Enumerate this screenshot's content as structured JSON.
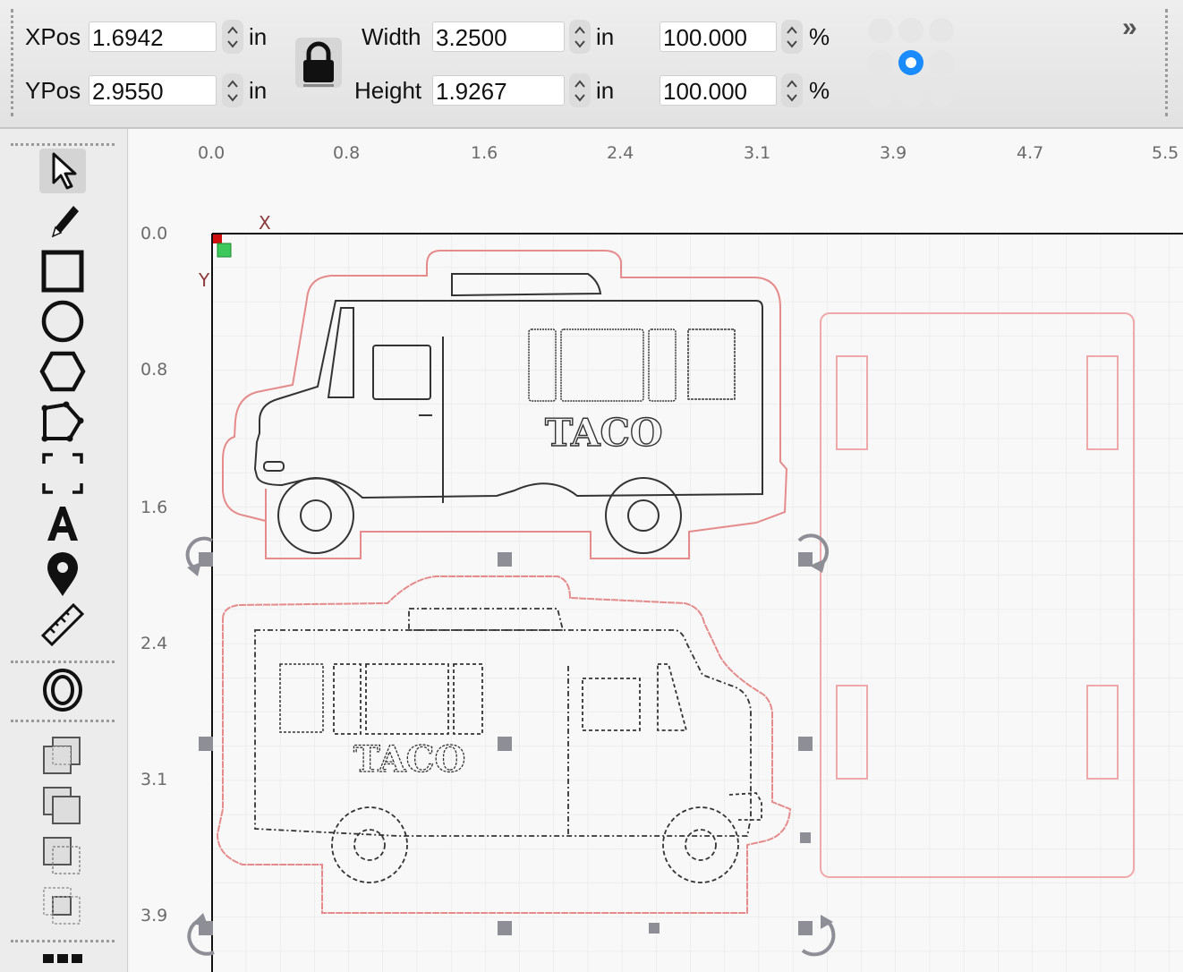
{
  "toolbar": {
    "xpos_label": "XPos",
    "xpos_value": "1.6942",
    "ypos_label": "YPos",
    "ypos_value": "2.9550",
    "width_label": "Width",
    "width_value": "3.2500",
    "height_label": "Height",
    "height_value": "1.9267",
    "unit": "in",
    "scale_x_value": "100.000",
    "scale_y_value": "100.000",
    "percent": "%",
    "more_label": "»"
  },
  "ruler": {
    "x_ticks": [
      "0.0",
      "0.8",
      "1.6",
      "2.4",
      "3.1",
      "3.9",
      "4.7",
      "5.5"
    ],
    "y_ticks": [
      "0.0",
      "0.8",
      "1.6",
      "2.4",
      "3.1",
      "3.9"
    ]
  },
  "canvas": {
    "origin_x_label": "X",
    "origin_y_label": "Y",
    "taco_text": "TACO"
  },
  "tools": [
    {
      "name": "select-icon"
    },
    {
      "name": "pencil-icon"
    },
    {
      "name": "rectangle-icon"
    },
    {
      "name": "ellipse-icon"
    },
    {
      "name": "polygon-icon"
    },
    {
      "name": "node-polygon-icon"
    },
    {
      "name": "frame-icon"
    },
    {
      "name": "text-icon",
      "label": "A"
    },
    {
      "name": "position-pin-icon"
    },
    {
      "name": "measure-icon"
    },
    {
      "name": "offset-icon"
    },
    {
      "name": "boolean-union-icon"
    },
    {
      "name": "boolean-subtract-icon"
    },
    {
      "name": "boolean-intersect-icon"
    },
    {
      "name": "boolean-exclude-icon"
    },
    {
      "name": "grid-array-icon"
    }
  ],
  "colors": {
    "accent": "#1a8cff",
    "cut_red": "#e58b8b",
    "handle_gray": "#8e8e96",
    "origin_red": "#d01010",
    "origin_green": "#3cc85a"
  }
}
